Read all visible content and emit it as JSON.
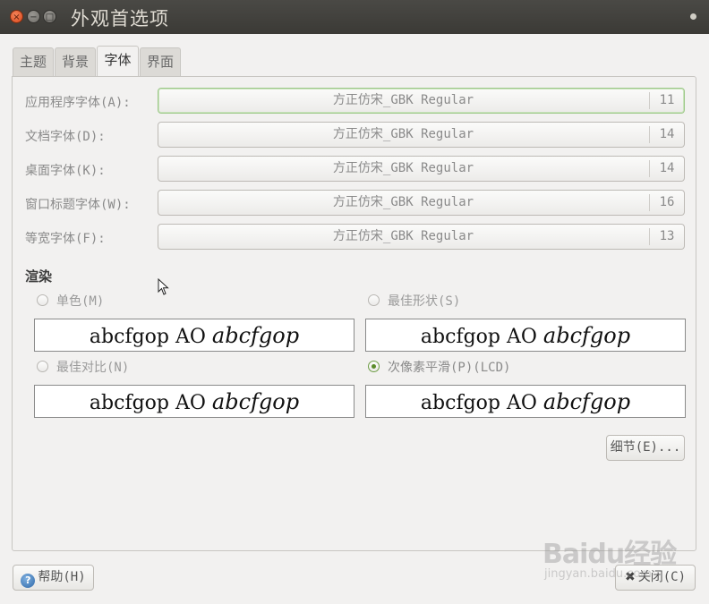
{
  "window": {
    "title": "外观首选项",
    "close_glyph": "×",
    "min_glyph": "−",
    "max_glyph": "□"
  },
  "tabs": [
    {
      "label": "主题"
    },
    {
      "label": "背景"
    },
    {
      "label": "字体",
      "active": true
    },
    {
      "label": "界面"
    }
  ],
  "fonts": [
    {
      "label": "应用程序字体(A):",
      "name": "方正仿宋_GBK Regular",
      "size": "11"
    },
    {
      "label": "文档字体(D):",
      "name": "方正仿宋_GBK Regular",
      "size": "14"
    },
    {
      "label": "桌面字体(K):",
      "name": "方正仿宋_GBK Regular",
      "size": "14"
    },
    {
      "label": "窗口标题字体(W):",
      "name": "方正仿宋_GBK Regular",
      "size": "16"
    },
    {
      "label": "等宽字体(F):",
      "name": "方正仿宋_GBK Regular",
      "size": "13"
    }
  ],
  "rendering": {
    "title": "渲染",
    "options": [
      {
        "label": "单色(M)",
        "selected": false,
        "preview_normal": "abcfgop AO ",
        "preview_italic": "abcfgop"
      },
      {
        "label": "最佳形状(S)",
        "selected": false,
        "preview_normal": "abcfgop AO ",
        "preview_italic": "abcfgop"
      },
      {
        "label": "最佳对比(N)",
        "selected": false,
        "preview_normal": "abcfgop AO ",
        "preview_italic": "abcfgop"
      },
      {
        "label": "次像素平滑(P)(LCD)",
        "selected": true,
        "preview_normal": "abcfgop AO ",
        "preview_italic": "abcfgop"
      }
    ]
  },
  "buttons": {
    "details": "细节(E)...",
    "help": "帮助(H)",
    "help_icon_glyph": "?",
    "close": "关闭(C)",
    "close_icon_glyph": "✖"
  },
  "watermark": {
    "brand": "Baidu经验",
    "sub": "jingyan.baidu.com"
  },
  "colors": {
    "accent_green": "#5a8c2a",
    "titlebar": "#3b3a36",
    "close_button": "#d9471c"
  }
}
